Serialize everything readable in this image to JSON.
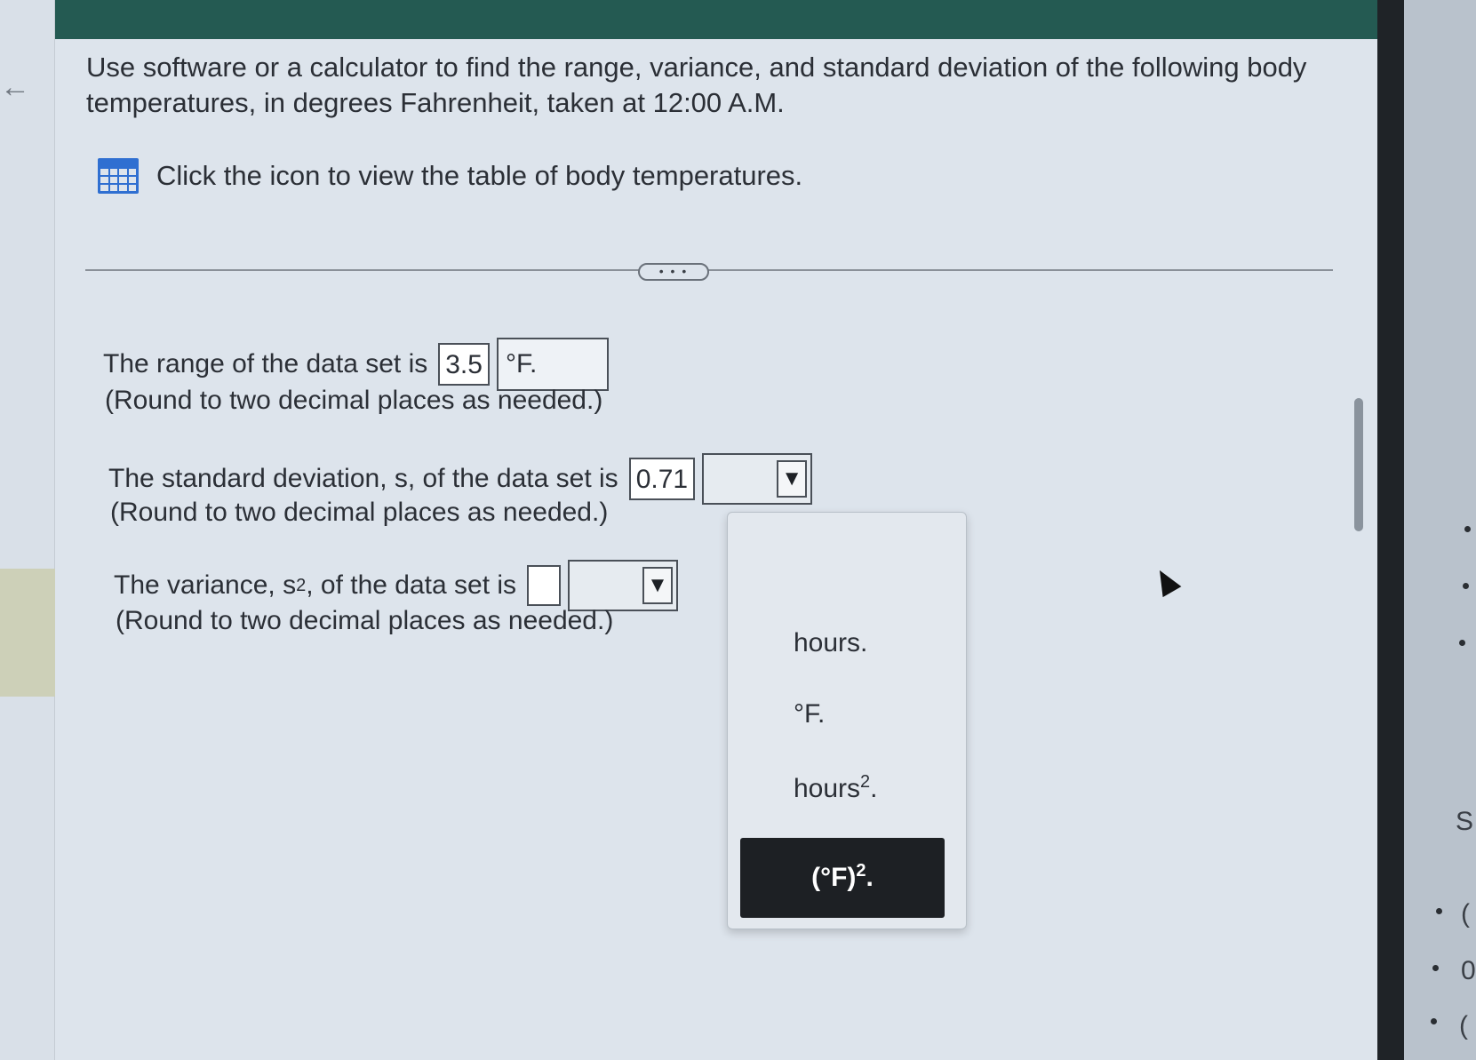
{
  "question": {
    "text": "Use software or a calculator to find the range, variance, and standard deviation of the following body temperatures, in degrees Fahrenheit, taken at 12:00 A.M."
  },
  "table_link": {
    "icon": "table-grid-icon",
    "text": "Click the icon to view the table of body temperatures."
  },
  "more_button": {
    "label": "• • •"
  },
  "range": {
    "prefix": "The range of the data set is",
    "value": "3.5",
    "unit": "°F.",
    "note": "(Round to two decimal places as needed.)"
  },
  "std_dev": {
    "prefix": "The standard deviation, s, of the data set is",
    "value": "0.71",
    "unit": "",
    "note": "(Round to two decimal places as needed.)"
  },
  "variance": {
    "prefix_a": "The variance, s",
    "prefix_sup": "2",
    "prefix_b": ", of the data set is",
    "value": "",
    "unit": "",
    "note": "(Round to two decimal places as needed.)"
  },
  "unit_menu": {
    "options": [
      {
        "base": "hours.",
        "sup": "",
        "tail": ""
      },
      {
        "base": "°F.",
        "sup": "",
        "tail": ""
      },
      {
        "base": "hours",
        "sup": "2",
        "tail": "."
      },
      {
        "base": "(°F)",
        "sup": "2",
        "tail": "."
      }
    ],
    "selected_index": 3
  },
  "caret_glyph": "▼",
  "side_marks": [
    "S",
    "(",
    "0",
    "("
  ],
  "colors": {
    "top_bar": "#245a52",
    "content_bg": "#dde4ec",
    "selected_option_bg": "#1d2024",
    "table_icon": "#2f6fd1"
  }
}
